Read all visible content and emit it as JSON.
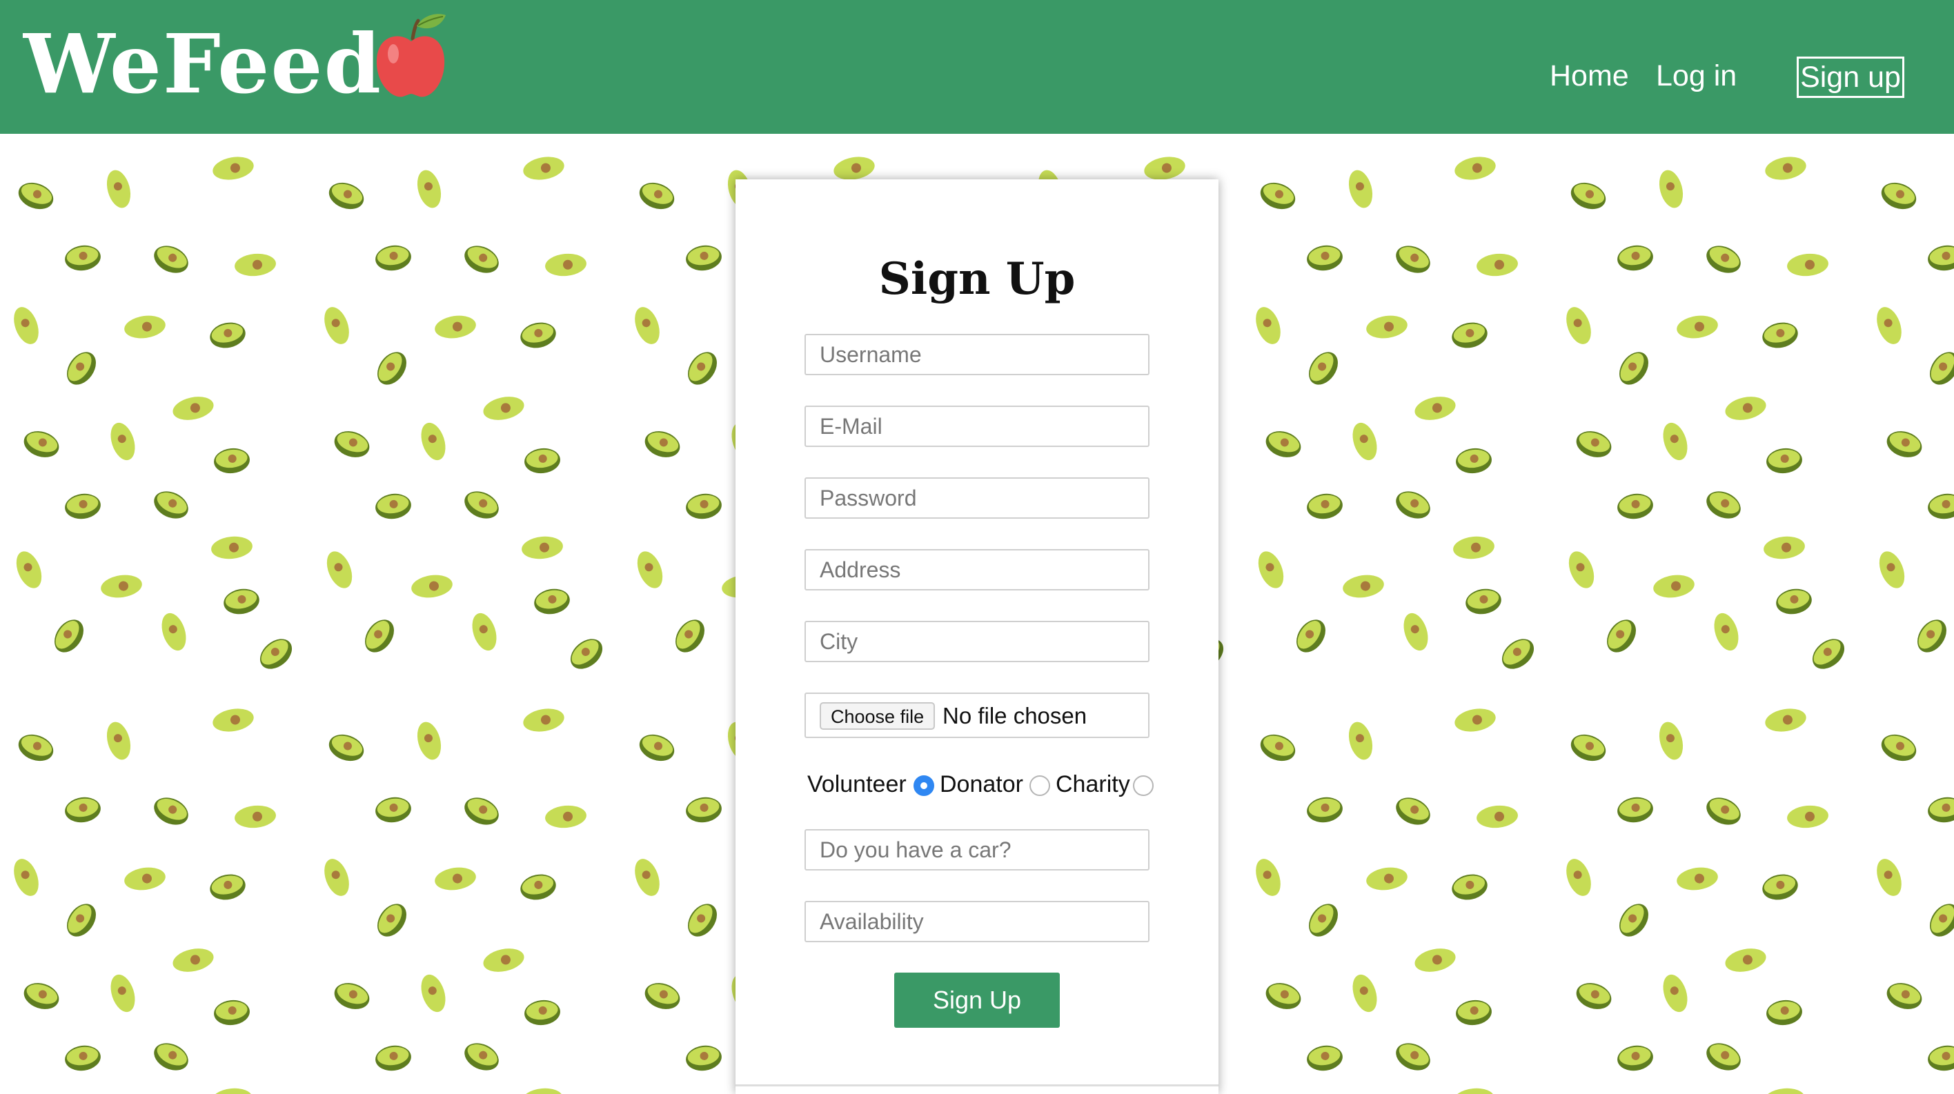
{
  "header": {
    "logo_text": "WeFeed",
    "logo_icon": "apple-icon",
    "nav": {
      "home": "Home",
      "login": "Log in",
      "signup": "Sign up"
    }
  },
  "background": {
    "pattern_icon": "avocado-icon"
  },
  "form": {
    "title": "Sign Up",
    "fields": {
      "username": {
        "placeholder": "Username",
        "value": ""
      },
      "email": {
        "placeholder": "E-Mail",
        "value": ""
      },
      "password": {
        "placeholder": "Password",
        "value": ""
      },
      "address": {
        "placeholder": "Address",
        "value": ""
      },
      "city": {
        "placeholder": "City",
        "value": ""
      },
      "car": {
        "placeholder": "Do you have a car?",
        "value": ""
      },
      "availability": {
        "placeholder": "Availability",
        "value": ""
      }
    },
    "file": {
      "button_label": "Choose file",
      "status": "No file chosen"
    },
    "roles": {
      "options": [
        "Volunteer",
        "Donator",
        "Charity"
      ],
      "selected": "Volunteer"
    },
    "submit_label": "Sign Up"
  },
  "colors": {
    "brand_green": "#3a9966",
    "radio_selected": "#2f87f2",
    "avocado_skin": "#5e7d1f",
    "avocado_flesh": "#c6dc55",
    "avocado_pit": "#a87a3c"
  }
}
